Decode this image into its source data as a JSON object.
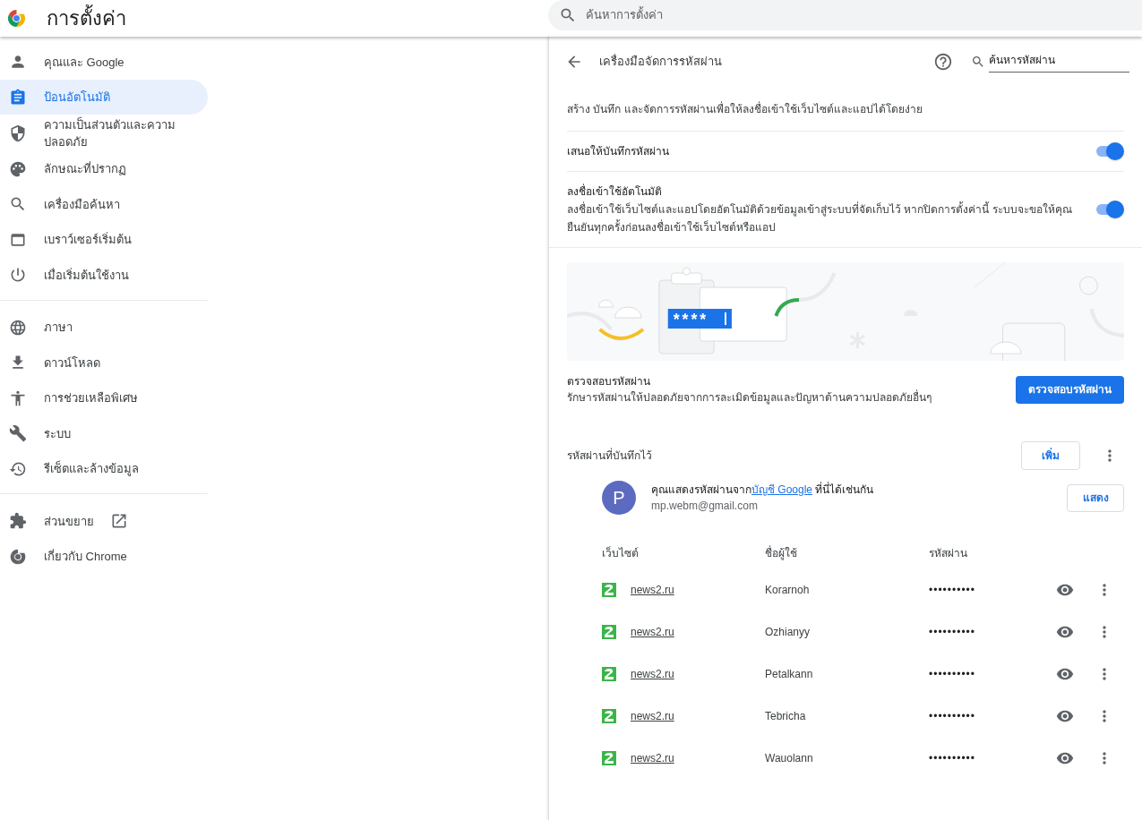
{
  "header": {
    "title": "การตั้งค่า",
    "search": {
      "placeholder": "ค้นหาการตั้งค่า"
    }
  },
  "sidebar": {
    "groups": [
      [
        {
          "label": "คุณและ Google",
          "selected": false,
          "external": false
        },
        {
          "label": "ป้อนอัตโนมัติ",
          "selected": true,
          "external": false
        },
        {
          "label": "ความเป็นส่วนตัวและความปลอดภัย",
          "selected": false,
          "external": false
        },
        {
          "label": "ลักษณะที่ปรากฏ",
          "selected": false,
          "external": false
        },
        {
          "label": "เครื่องมือค้นหา",
          "selected": false,
          "external": false
        },
        {
          "label": "เบราว์เซอร์เริ่มต้น",
          "selected": false,
          "external": false
        },
        {
          "label": "เมื่อเริ่มต้นใช้งาน",
          "selected": false,
          "external": false
        }
      ],
      [
        {
          "label": "ภาษา",
          "selected": false,
          "external": false
        },
        {
          "label": "ดาวน์โหลด",
          "selected": false,
          "external": false
        },
        {
          "label": "การช่วยเหลือพิเศษ",
          "selected": false,
          "external": false
        },
        {
          "label": "ระบบ",
          "selected": false,
          "external": false
        },
        {
          "label": "รีเซ็ตและล้างข้อมูล",
          "selected": false,
          "external": false
        }
      ],
      [
        {
          "label": "ส่วนขยาย",
          "selected": false,
          "external": true
        },
        {
          "label": "เกี่ยวกับ Chrome",
          "selected": false,
          "external": false
        }
      ]
    ]
  },
  "main": {
    "title": "เครื่องมือจัดการรหัสผ่าน",
    "search": {
      "placeholder": "ค้นหารหัสผ่าน"
    },
    "description": "สร้าง บันทึก และจัดการรหัสผ่านเพื่อให้ลงชื่อเข้าใช้เว็บไซต์และแอปได้โดยง่าย",
    "settings": [
      {
        "title": "เสนอให้บันทึกรหัสผ่าน",
        "on": true
      },
      {
        "title": "ลงชื่อเข้าใช้อัตโนมัติ",
        "description": "ลงชื่อเข้าใช้เว็บไซต์และแอปโดยอัตโนมัติด้วยข้อมูลเข้าสู่ระบบที่จัดเก็บไว้ หากปิดการตั้งค่านี้ ระบบจะขอให้คุณยืนยันทุกครั้งก่อนลงชื่อเข้าใช้เว็บไซต์หรือแอป",
        "on": true
      }
    ],
    "illustration": {
      "field_text": "****"
    },
    "check": {
      "title": "ตรวจสอบรหัสผ่าน",
      "description": "รักษารหัสผ่านให้ปลอดภัยจากการละเมิดข้อมูลและปัญหาด้านความปลอดภัยอื่นๆ",
      "button": "ตรวจสอบรหัสผ่าน"
    },
    "saved": {
      "title": "รหัสผ่านที่บันทึกไว้",
      "add_button": "เพิ่ม",
      "account": {
        "avatar": "P",
        "color": "#5c6bc0",
        "text_before": "คุณแสดงรหัสผ่านจาก",
        "link": "บัญชี Google",
        "text_after": " ที่นี่ได้เช่นกัน",
        "email": "mp.webm@gmail.com",
        "button": "แสดง"
      },
      "columns": [
        "เว็บไซต์",
        "ชื่อผู้ใช้",
        "รหัสผ่าน"
      ],
      "rows": [
        {
          "site": "news2.ru",
          "username": "Korarnoh",
          "password": "••••••••••"
        },
        {
          "site": "news2.ru",
          "username": "Ozhianyy",
          "password": "••••••••••"
        },
        {
          "site": "news2.ru",
          "username": "Petalkann",
          "password": "••••••••••"
        },
        {
          "site": "news2.ru",
          "username": "Tebricha",
          "password": "••••••••••"
        },
        {
          "site": "news2.ru",
          "username": "Wauolann",
          "password": "••••••••••"
        }
      ]
    }
  }
}
